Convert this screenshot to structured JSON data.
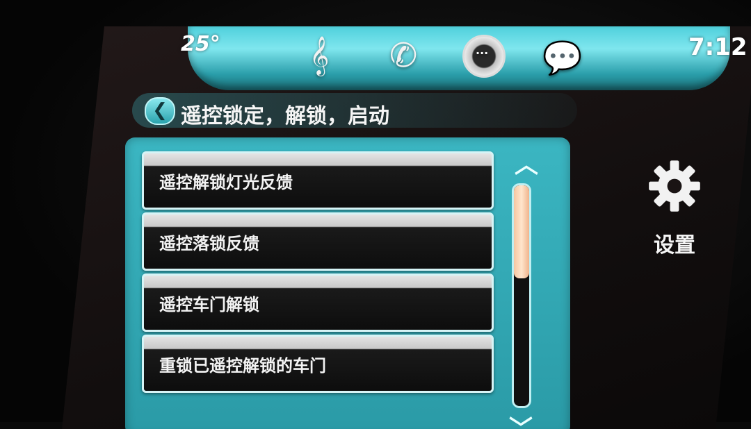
{
  "status": {
    "temperature": "25°",
    "time": "7:12"
  },
  "top_icons": [
    {
      "name": "music-note-icon",
      "glyph": "𝄞"
    },
    {
      "name": "phone-icon",
      "glyph": "✆"
    },
    {
      "name": "navigation-icon",
      "glyph": ""
    },
    {
      "name": "message-bubbles-icon",
      "glyph": "💬"
    }
  ],
  "header": {
    "back_glyph": "❮",
    "title": "遥控锁定，解锁，启动"
  },
  "list": {
    "items": [
      {
        "label": "遥控解锁灯光反馈"
      },
      {
        "label": "遥控落锁反馈"
      },
      {
        "label": "遥控车门解锁"
      },
      {
        "label": "重锁已遥控解锁的车门"
      }
    ],
    "scroll_position": 0.42
  },
  "settings": {
    "label": "设置"
  },
  "colors": {
    "accent": "#3bb6c2",
    "scroll_thumb": "#f6c6a0"
  }
}
